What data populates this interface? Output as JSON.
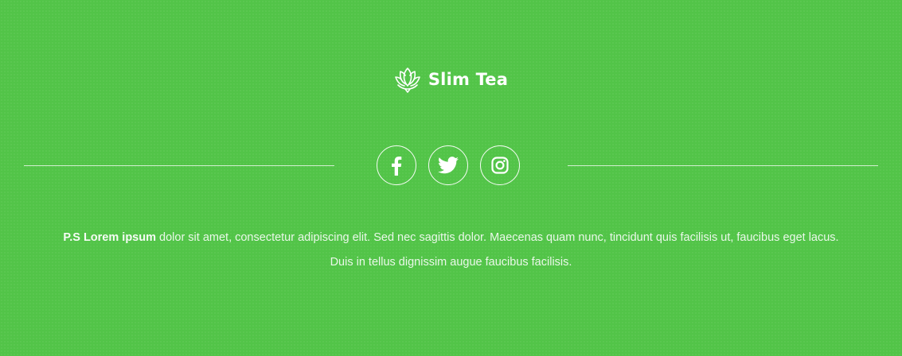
{
  "brand": {
    "name": "Slim Tea",
    "logo_icon": "lotus-icon"
  },
  "social": [
    {
      "network": "facebook",
      "icon": "facebook-icon"
    },
    {
      "network": "twitter",
      "icon": "twitter-icon"
    },
    {
      "network": "instagram",
      "icon": "instagram-icon"
    }
  ],
  "note": {
    "lead": "P.S Lorem ipsum",
    "line1": " dolor sit amet, consectetur adipiscing elit. Sed nec sagittis dolor. Maecenas quam nunc, tincidunt quis facilisis ut, faucibus eget lacus.",
    "line2": "Duis in tellus dignissim augue faucibus facilisis."
  },
  "colors": {
    "background": "#52c448",
    "foreground": "#ffffff"
  }
}
